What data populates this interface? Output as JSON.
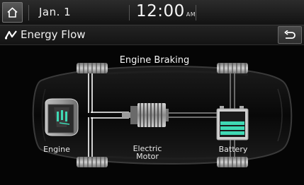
{
  "status_bar": {
    "date": "Jan.  1",
    "time": "12:00",
    "ampm": "AM"
  },
  "header": {
    "title": "Energy Flow",
    "home_icon": "home-icon",
    "title_icon": "energy-flow-icon",
    "back_icon": "back-arrow-icon"
  },
  "energy_flow": {
    "state": "Engine Braking",
    "components": {
      "engine": "Engine",
      "motor": "Electric Motor",
      "battery": "Battery"
    },
    "accent_color": "#3fd9b4"
  }
}
